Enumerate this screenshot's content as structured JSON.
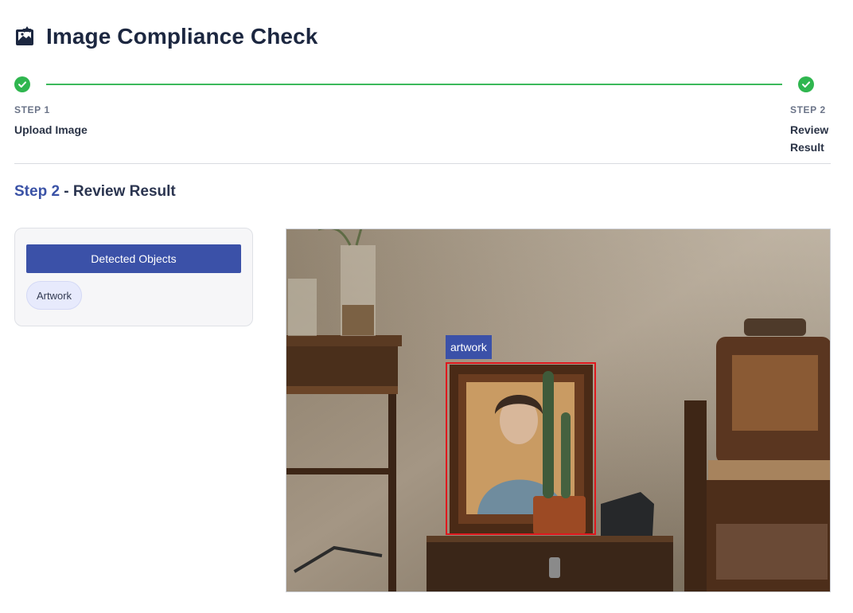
{
  "header": {
    "title": "Image Compliance Check",
    "icon": "image-check-icon"
  },
  "stepper": {
    "steps": [
      {
        "number": "STEP 1",
        "title": "Upload Image",
        "status": "complete"
      },
      {
        "number": "STEP 2",
        "title": "Review Result",
        "status": "complete"
      }
    ],
    "complete_color": "#2fb64f"
  },
  "section": {
    "step_label": "Step 2",
    "separator": " - ",
    "title": "Review Result"
  },
  "detected_panel": {
    "button_label": "Detected Objects",
    "objects": [
      "Artwork"
    ]
  },
  "image_view": {
    "detections": [
      {
        "label": "artwork",
        "box_color": "#e0181d"
      }
    ]
  },
  "colors": {
    "accent": "#3b51a8",
    "success": "#2fb64f",
    "text": "#1c2740"
  }
}
